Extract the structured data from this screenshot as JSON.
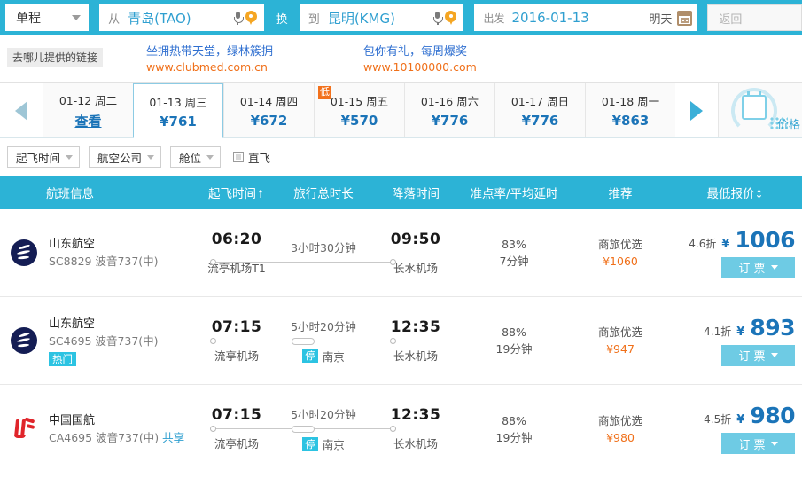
{
  "search": {
    "trip_type": "单程",
    "from_label": "从",
    "from_value": "青岛(TAO)",
    "swap_label": "—换—",
    "to_label": "到",
    "to_value": "昆明(KMG)",
    "depart_label": "出发",
    "depart_value": "2016-01-13",
    "tomorrow_label": "明天",
    "return_placeholder": "返回"
  },
  "ads": {
    "provider_label": "去哪儿提供的链接",
    "items": [
      {
        "title": "坐拥热带天堂，绿林簇拥",
        "url": "www.clubmed.com.cn"
      },
      {
        "title": "包你有礼，每周爆奖",
        "url": "www.10100000.com"
      }
    ]
  },
  "datestrip": {
    "days": [
      {
        "label": "01-12 周二",
        "price": "查看",
        "is_link": true,
        "active": false,
        "low": ""
      },
      {
        "label": "01-13 周三",
        "price": "¥761",
        "is_link": false,
        "active": true,
        "low": ""
      },
      {
        "label": "01-14 周四",
        "price": "¥672",
        "is_link": false,
        "active": false,
        "low": ""
      },
      {
        "label": "01-15 周五",
        "price": "¥570",
        "is_link": false,
        "active": false,
        "low": "低"
      },
      {
        "label": "01-16 周六",
        "price": "¥776",
        "is_link": false,
        "active": false,
        "low": ""
      },
      {
        "label": "01-17 周日",
        "price": "¥776",
        "is_link": false,
        "active": false,
        "low": ""
      },
      {
        "label": "01-18 周一",
        "price": "¥863",
        "is_link": false,
        "active": false,
        "low": ""
      }
    ],
    "price_calendar_label": "价格日历"
  },
  "filters": {
    "buttons": [
      "起飞时间",
      "航空公司",
      "舱位"
    ],
    "direct_label": "直飞",
    "direct_checked": false
  },
  "table": {
    "headers": {
      "info": "航班信息",
      "departure": "起飞时间",
      "departure_sort": "↑",
      "duration": "旅行总时长",
      "arrival": "降落时间",
      "punctuality": "准点率/平均延时",
      "recommend": "推荐",
      "price": "最低报价",
      "price_sort": "↕"
    },
    "rows": [
      {
        "logo": "shandong-airlines-logo",
        "airline": "山东航空",
        "flight_no": "SC8829 波音737(中)",
        "share_tag": "",
        "hot_tag": "",
        "dep_time": "06:20",
        "dep_airport": "流亭机场T1",
        "duration": "3小时30分钟",
        "has_stop": false,
        "stop_badge": "",
        "stop_city": "",
        "arr_time": "09:50",
        "arr_airport": "长水机场",
        "punct_rate": "83%",
        "avg_delay": "7分钟",
        "rec_name": "商旅优选",
        "rec_price": "¥1060",
        "discount": "4.6折",
        "currency": "¥",
        "price": "1006",
        "book_label": "订 票"
      },
      {
        "logo": "shandong-airlines-logo",
        "airline": "山东航空",
        "flight_no": "SC4695 波音737(中)",
        "share_tag": "",
        "hot_tag": "热门",
        "dep_time": "07:15",
        "dep_airport": "流亭机场",
        "duration": "5小时20分钟",
        "has_stop": true,
        "stop_badge": "停",
        "stop_city": "南京",
        "arr_time": "12:35",
        "arr_airport": "长水机场",
        "punct_rate": "88%",
        "avg_delay": "19分钟",
        "rec_name": "商旅优选",
        "rec_price": "¥947",
        "discount": "4.1折",
        "currency": "¥",
        "price": "893",
        "book_label": "订 票"
      },
      {
        "logo": "air-china-logo",
        "airline": "中国国航",
        "flight_no": "CA4695 波音737(中)",
        "share_tag": "共享",
        "hot_tag": "",
        "dep_time": "07:15",
        "dep_airport": "流亭机场",
        "duration": "5小时20分钟",
        "has_stop": true,
        "stop_badge": "停",
        "stop_city": "南京",
        "arr_time": "12:35",
        "arr_airport": "长水机场",
        "punct_rate": "88%",
        "avg_delay": "19分钟",
        "rec_name": "商旅优选",
        "rec_price": "¥980",
        "discount": "4.5折",
        "currency": "¥",
        "price": "980",
        "book_label": "订 票"
      }
    ]
  },
  "colors": {
    "brand": "#2cb3d6",
    "price": "#1b74b8",
    "accent_orange": "#f0701a",
    "badge_cyan": "#2cc3e2"
  }
}
